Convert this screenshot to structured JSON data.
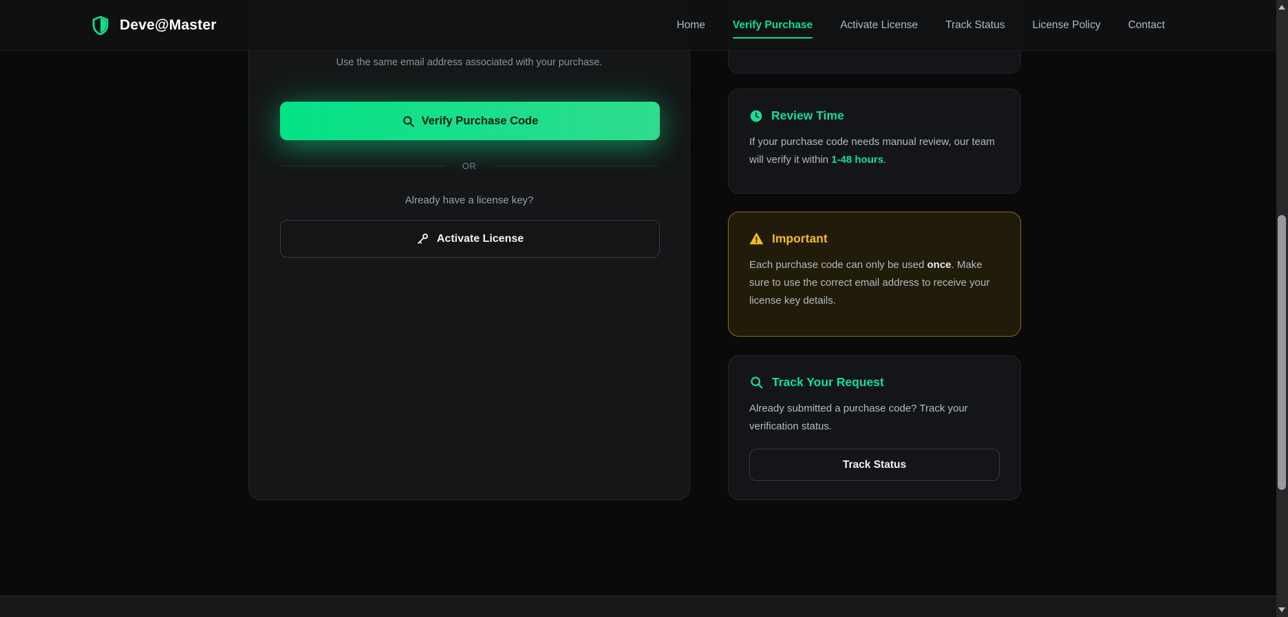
{
  "brand": {
    "name": "Deve@Master"
  },
  "nav": {
    "items": [
      {
        "label": "Home",
        "active": false
      },
      {
        "label": "Verify Purchase",
        "active": true
      },
      {
        "label": "Activate License",
        "active": false
      },
      {
        "label": "Track Status",
        "active": false
      },
      {
        "label": "License Policy",
        "active": false
      },
      {
        "label": "Contact",
        "active": false
      }
    ]
  },
  "verify_panel": {
    "email_hint": "Use the same email address associated with your purchase.",
    "verify_button_label": "Verify Purchase Code",
    "or_label": "OR",
    "license_key_prompt": "Already have a license key?",
    "activate_button_label": "Activate License"
  },
  "info_cards": {
    "review_time": {
      "title": "Review Time",
      "text_before": "If your purchase code needs manual review, our team will verify it within ",
      "highlight": "1-48 hours",
      "text_after": "."
    },
    "important": {
      "title": "Important",
      "text_before": "Each purchase code can only be used ",
      "bold": "once",
      "text_after": ". Make sure to use the correct email address to receive your license key details."
    },
    "track": {
      "title": "Track Your Request",
      "text": "Already submitted a purchase code? Track your verification status.",
      "button_label": "Track Status"
    }
  },
  "colors": {
    "accent_green": "#10e08e",
    "warning_amber": "#f6bc20",
    "page_background": "#0a0a0b",
    "card_background": "#141518",
    "important_card_background": "#211b09"
  }
}
